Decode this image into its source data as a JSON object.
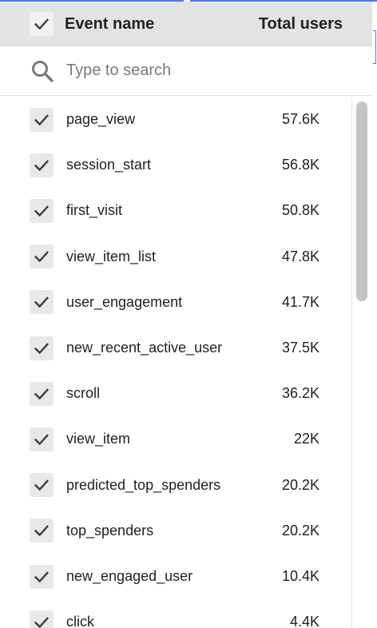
{
  "header": {
    "event_name_label": "Event name",
    "total_users_label": "Total users",
    "select_all_checked": true
  },
  "search": {
    "placeholder": "Type to search",
    "value": ""
  },
  "rows": [
    {
      "name": "page_view",
      "users": "57.6K",
      "checked": true
    },
    {
      "name": "session_start",
      "users": "56.8K",
      "checked": true
    },
    {
      "name": "first_visit",
      "users": "50.8K",
      "checked": true
    },
    {
      "name": "view_item_list",
      "users": "47.8K",
      "checked": true
    },
    {
      "name": "user_engagement",
      "users": "41.7K",
      "checked": true
    },
    {
      "name": "new_recent_active_user",
      "users": "37.5K",
      "checked": true
    },
    {
      "name": "scroll",
      "users": "36.2K",
      "checked": true
    },
    {
      "name": "view_item",
      "users": "22K",
      "checked": true
    },
    {
      "name": "predicted_top_spenders",
      "users": "20.2K",
      "checked": true
    },
    {
      "name": "top_spenders",
      "users": "20.2K",
      "checked": true
    },
    {
      "name": "new_engaged_user",
      "users": "10.4K",
      "checked": true
    },
    {
      "name": "click",
      "users": "4.4K",
      "checked": true
    }
  ],
  "icons": {
    "checkbox": "check-icon",
    "search": "search-icon"
  },
  "colors": {
    "header_bg": "#e3e3e3",
    "checkbox_bg": "#e8e8e8",
    "check_mark": "#3c3c3c",
    "accent_blue": "#4d79e6",
    "scroll_thumb": "#c4c4c4"
  }
}
